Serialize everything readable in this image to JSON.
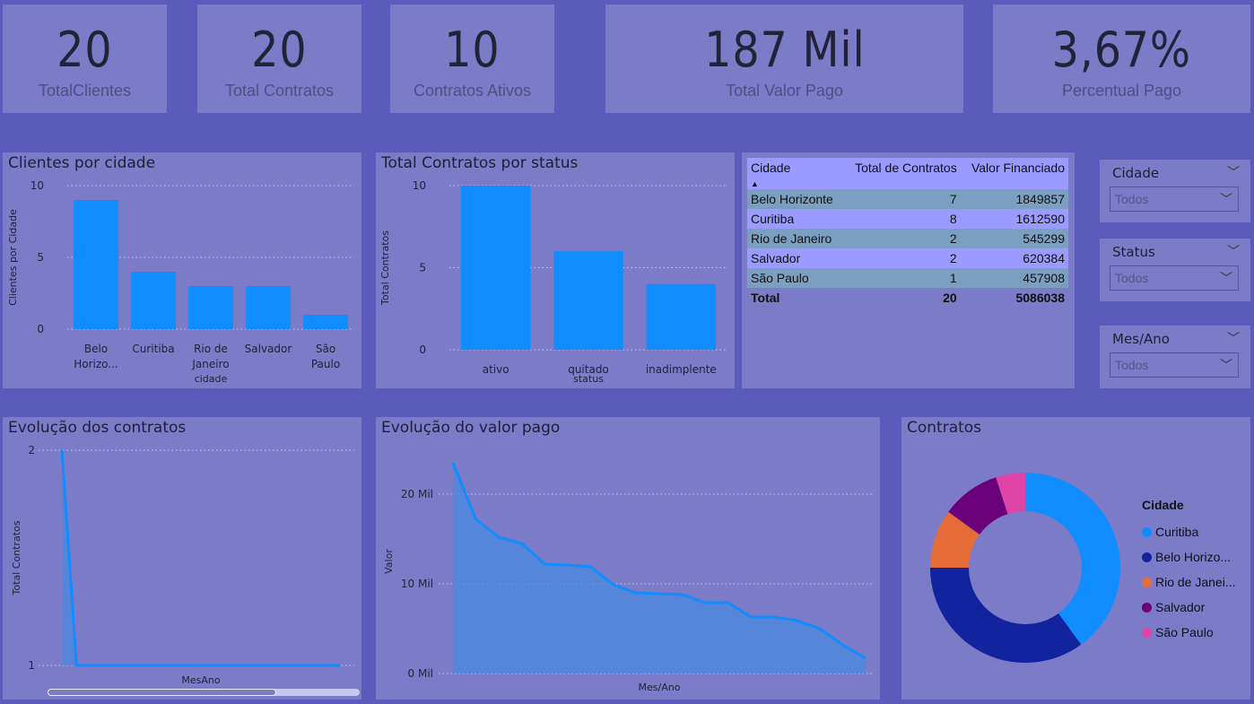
{
  "cards": [
    {
      "value": "20",
      "label": "TotalClientes"
    },
    {
      "value": "20",
      "label": "Total Contratos"
    },
    {
      "value": "10",
      "label": "Contratos Ativos"
    },
    {
      "value": "187 Mil",
      "label": "Total Valor Pago"
    },
    {
      "value": "3,67%",
      "label": "Percentual Pago"
    }
  ],
  "clientes_chart": {
    "title": "Clientes por cidade"
  },
  "status_chart": {
    "title": "Total Contratos por status"
  },
  "evolucao_contratos": {
    "title": "Evolução dos contratos"
  },
  "evolucao_valor": {
    "title": "Evolução do valor pago"
  },
  "donut": {
    "title": "Contratos"
  },
  "table": {
    "headers": [
      "Cidade",
      "Total de Contratos",
      "Valor Financiado"
    ],
    "sort_icon": "sort-asc-icon",
    "rows": [
      [
        "Belo Horizonte",
        "7",
        "1849857"
      ],
      [
        "Curitiba",
        "8",
        "1612590"
      ],
      [
        "Rio de Janeiro",
        "2",
        "545299"
      ],
      [
        "Salvador",
        "2",
        "620384"
      ],
      [
        "São Paulo",
        "1",
        "457908"
      ]
    ],
    "total": [
      "Total",
      "20",
      "5086038"
    ]
  },
  "slicers": [
    {
      "title": "Cidade",
      "value": "Todos"
    },
    {
      "title": "Status",
      "value": "Todos"
    },
    {
      "title": "Mes/Ano",
      "value": "Todos"
    }
  ],
  "colors": {
    "bar": "#118dff",
    "background": "#5b5bbb",
    "panel": "#7b7bc7"
  },
  "chart_data": [
    {
      "type": "bar",
      "title": "Clientes por cidade",
      "xlabel": "cidade",
      "ylabel": "Clientes por Cidade",
      "categories": [
        "Belo Horizo...",
        "Curitiba",
        "Rio de Janeiro",
        "Salvador",
        "São Paulo"
      ],
      "values": [
        9,
        4,
        3,
        3,
        1
      ],
      "yticks": [
        "0",
        "5",
        "10"
      ],
      "ylim": [
        0,
        10
      ]
    },
    {
      "type": "bar",
      "title": "Total Contratos por status",
      "xlabel": "status",
      "ylabel": "Total Contratos",
      "categories": [
        "ativo",
        "quitado",
        "inadimplente"
      ],
      "values": [
        10,
        6,
        4
      ],
      "yticks": [
        "0",
        "5",
        "10"
      ],
      "ylim": [
        0,
        10
      ]
    },
    {
      "type": "area",
      "title": "Evolução dos contratos",
      "xlabel": "MesAno",
      "ylabel": "Total Contratos",
      "values": [
        2,
        1,
        1,
        1,
        1,
        1,
        1,
        1,
        1,
        1,
        1,
        1,
        1,
        1,
        1,
        1,
        1,
        1,
        1,
        1
      ],
      "yticks": [
        "1",
        "2"
      ],
      "ylim": [
        1,
        2
      ]
    },
    {
      "type": "area",
      "title": "Evolução do valor pago",
      "xlabel": "Mes/Ano",
      "ylabel": "Valor",
      "values": [
        23.5,
        17.2,
        15.2,
        14.5,
        12.2,
        12.1,
        11.9,
        9.9,
        9.0,
        8.9,
        8.8,
        7.9,
        7.9,
        6.3,
        6.3,
        5.9,
        5.0,
        3.2,
        1.7
      ],
      "yticks": [
        "0 Mil",
        "10 Mil",
        "20 Mil"
      ],
      "ylim": [
        0,
        25
      ]
    },
    {
      "type": "pie",
      "title": "Contratos",
      "legend_title": "Cidade",
      "labels": [
        "Curitiba",
        "Belo Horizo...",
        "Rio de Janei...",
        "Salvador",
        "São Paulo"
      ],
      "values": [
        8,
        7,
        2,
        2,
        1
      ],
      "colors": [
        "#118dff",
        "#12239e",
        "#e66c37",
        "#6b007b",
        "#e044a7"
      ]
    }
  ]
}
